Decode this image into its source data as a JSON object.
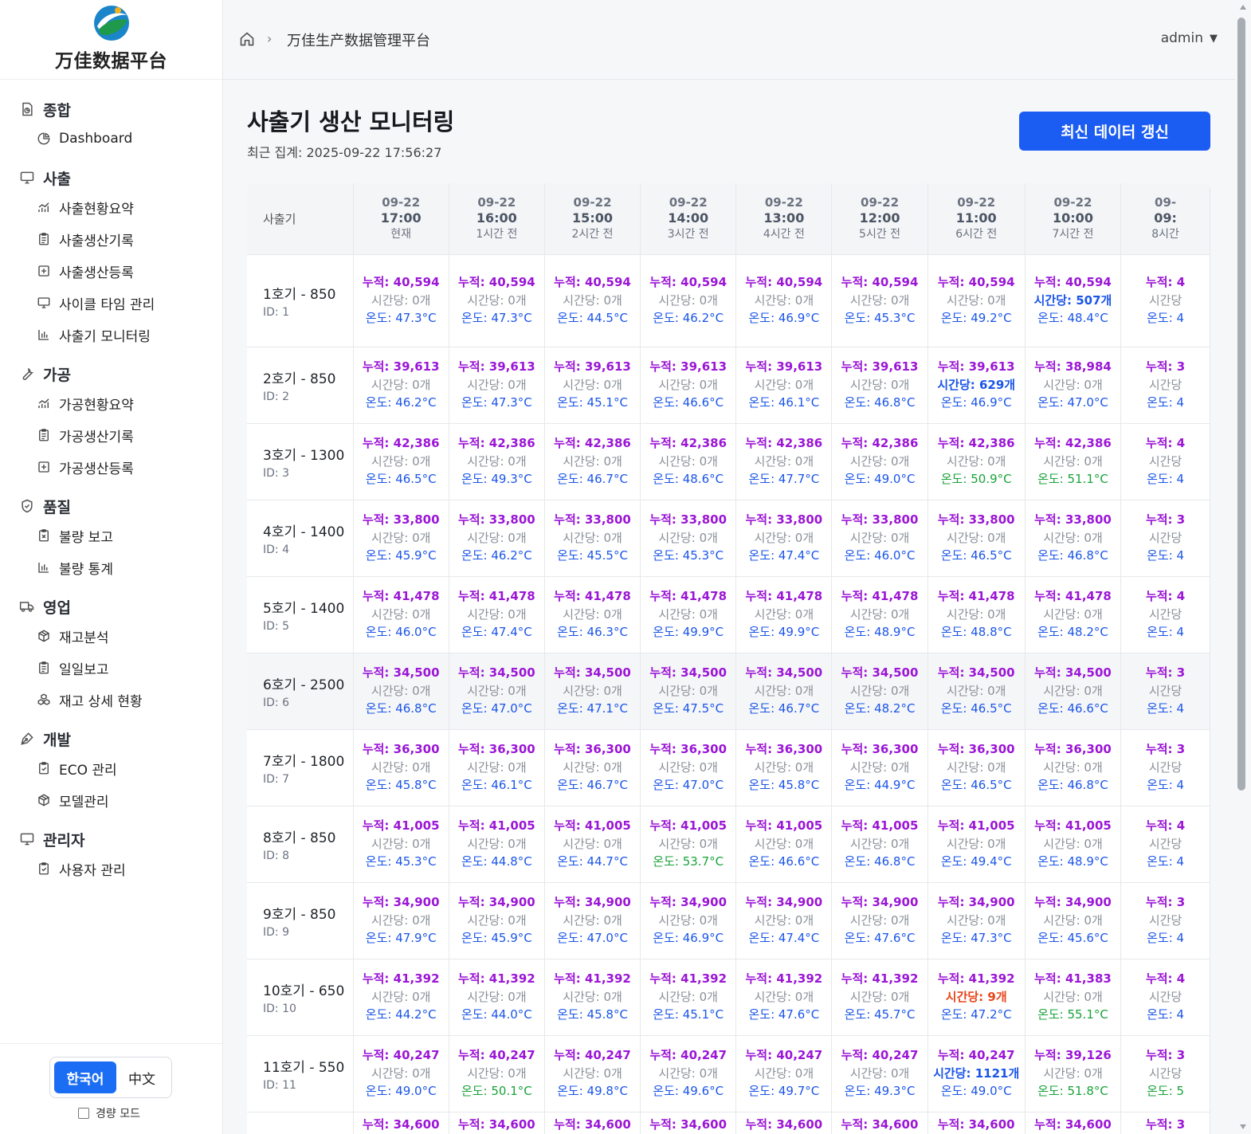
{
  "app": {
    "logo_text": "万佳数据平台"
  },
  "header": {
    "breadcrumb": "万佳生产数据管理平台",
    "user": "admin"
  },
  "sidebar": {
    "groups": [
      {
        "title": "종합",
        "icon": "overview-icon",
        "items": [
          {
            "label": "Dashboard",
            "icon": "pie-chart-icon"
          }
        ]
      },
      {
        "title": "사출",
        "icon": "monitor-icon",
        "items": [
          {
            "label": "사출현황요약",
            "icon": "line-chart-icon"
          },
          {
            "label": "사출생산기록",
            "icon": "clipboard-icon"
          },
          {
            "label": "사출생산등록",
            "icon": "plus-square-icon"
          },
          {
            "label": "사이클 타임 관리",
            "icon": "monitor-icon"
          },
          {
            "label": "사출기 모니터링",
            "icon": "bar-chart-icon"
          }
        ]
      },
      {
        "title": "가공",
        "icon": "wrench-icon",
        "items": [
          {
            "label": "가공현황요약",
            "icon": "line-chart-icon"
          },
          {
            "label": "가공생산기록",
            "icon": "clipboard-icon"
          },
          {
            "label": "가공생산등록",
            "icon": "plus-square-icon"
          }
        ]
      },
      {
        "title": "품질",
        "icon": "shield-icon",
        "items": [
          {
            "label": "불량 보고",
            "icon": "clipboard-x-icon"
          },
          {
            "label": "불량 통계",
            "icon": "bar-chart-icon"
          }
        ]
      },
      {
        "title": "영업",
        "icon": "truck-icon",
        "items": [
          {
            "label": "재고분석",
            "icon": "package-icon"
          },
          {
            "label": "일일보고",
            "icon": "clipboard-icon"
          },
          {
            "label": "재고 상세 현황",
            "icon": "boxes-icon"
          }
        ]
      },
      {
        "title": "개발",
        "icon": "pen-tool-icon",
        "items": [
          {
            "label": "ECO 관리",
            "icon": "clipboard-check-icon"
          },
          {
            "label": "모델관리",
            "icon": "package-icon"
          }
        ]
      },
      {
        "title": "관리자",
        "icon": "monitor-icon",
        "items": [
          {
            "label": "사용자 관리",
            "icon": "clipboard-check-icon"
          }
        ]
      }
    ],
    "languages": {
      "active": "한국어",
      "other": "中文"
    },
    "light_mode_label": "경량 모드",
    "light_mode_checked": false
  },
  "page": {
    "title": "사출기 생산 모니터링",
    "last_updated": "최근 집계: 2025-09-22 17:56:27",
    "refresh_label": "최신 데이터 갱신"
  },
  "table": {
    "machine_header": "사출기",
    "columns": [
      {
        "date": "09-22",
        "time": "17:00",
        "ago": "현재"
      },
      {
        "date": "09-22",
        "time": "16:00",
        "ago": "1시간 전"
      },
      {
        "date": "09-22",
        "time": "15:00",
        "ago": "2시간 전"
      },
      {
        "date": "09-22",
        "time": "14:00",
        "ago": "3시간 전"
      },
      {
        "date": "09-22",
        "time": "13:00",
        "ago": "4시간 전"
      },
      {
        "date": "09-22",
        "time": "12:00",
        "ago": "5시간 전"
      },
      {
        "date": "09-22",
        "time": "11:00",
        "ago": "6시간 전"
      },
      {
        "date": "09-22",
        "time": "10:00",
        "ago": "7시간 전"
      },
      {
        "date": "09-",
        "time": "09:",
        "ago": "8시간"
      }
    ],
    "rows": [
      {
        "name": "1호기 - 850",
        "id": "ID: 1",
        "cells": [
          [
            "누적: 40,594",
            "시간당: 0개",
            "온도: 47.3°C",
            "",
            ""
          ],
          [
            "누적: 40,594",
            "시간당: 0개",
            "온도: 47.3°C",
            "",
            ""
          ],
          [
            "누적: 40,594",
            "시간당: 0개",
            "온도: 44.5°C",
            "",
            ""
          ],
          [
            "누적: 40,594",
            "시간당: 0개",
            "온도: 46.2°C",
            "",
            ""
          ],
          [
            "누적: 40,594",
            "시간당: 0개",
            "온도: 46.9°C",
            "",
            ""
          ],
          [
            "누적: 40,594",
            "시간당: 0개",
            "온도: 45.3°C",
            "",
            ""
          ],
          [
            "누적: 40,594",
            "시간당: 0개",
            "온도: 49.2°C",
            "",
            ""
          ],
          [
            "누적: 40,594",
            "시간당: 507개",
            "온도: 48.4°C",
            "hi",
            ""
          ],
          [
            "누적: 4",
            "시간당",
            "온도: 4",
            "",
            ""
          ]
        ]
      },
      {
        "name": "2호기 - 850",
        "id": "ID: 2",
        "cells": [
          [
            "누적: 39,613",
            "시간당: 0개",
            "온도: 46.2°C",
            "",
            ""
          ],
          [
            "누적: 39,613",
            "시간당: 0개",
            "온도: 47.3°C",
            "",
            ""
          ],
          [
            "누적: 39,613",
            "시간당: 0개",
            "온도: 45.1°C",
            "",
            ""
          ],
          [
            "누적: 39,613",
            "시간당: 0개",
            "온도: 46.6°C",
            "",
            ""
          ],
          [
            "누적: 39,613",
            "시간당: 0개",
            "온도: 46.1°C",
            "",
            ""
          ],
          [
            "누적: 39,613",
            "시간당: 0개",
            "온도: 46.8°C",
            "",
            ""
          ],
          [
            "누적: 39,613",
            "시간당: 629개",
            "온도: 46.9°C",
            "hi",
            ""
          ],
          [
            "누적: 38,984",
            "시간당: 0개",
            "온도: 47.0°C",
            "",
            ""
          ],
          [
            "누적: 3",
            "시간당",
            "온도: 4",
            "",
            ""
          ]
        ]
      },
      {
        "name": "3호기 - 1300",
        "id": "ID: 3",
        "cells": [
          [
            "누적: 42,386",
            "시간당: 0개",
            "온도: 46.5°C",
            "",
            ""
          ],
          [
            "누적: 42,386",
            "시간당: 0개",
            "온도: 49.3°C",
            "",
            ""
          ],
          [
            "누적: 42,386",
            "시간당: 0개",
            "온도: 46.7°C",
            "",
            ""
          ],
          [
            "누적: 42,386",
            "시간당: 0개",
            "온도: 48.6°C",
            "",
            ""
          ],
          [
            "누적: 42,386",
            "시간당: 0개",
            "온도: 47.7°C",
            "",
            ""
          ],
          [
            "누적: 42,386",
            "시간당: 0개",
            "온도: 49.0°C",
            "",
            ""
          ],
          [
            "누적: 42,386",
            "시간당: 0개",
            "온도: 50.9°C",
            "",
            "ok"
          ],
          [
            "누적: 42,386",
            "시간당: 0개",
            "온도: 51.1°C",
            "",
            "ok"
          ],
          [
            "누적: 4",
            "시간당",
            "온도: 4",
            "",
            ""
          ]
        ]
      },
      {
        "name": "4호기 - 1400",
        "id": "ID: 4",
        "cells": [
          [
            "누적: 33,800",
            "시간당: 0개",
            "온도: 45.9°C",
            "",
            ""
          ],
          [
            "누적: 33,800",
            "시간당: 0개",
            "온도: 46.2°C",
            "",
            ""
          ],
          [
            "누적: 33,800",
            "시간당: 0개",
            "온도: 45.5°C",
            "",
            ""
          ],
          [
            "누적: 33,800",
            "시간당: 0개",
            "온도: 45.3°C",
            "",
            ""
          ],
          [
            "누적: 33,800",
            "시간당: 0개",
            "온도: 47.4°C",
            "",
            ""
          ],
          [
            "누적: 33,800",
            "시간당: 0개",
            "온도: 46.0°C",
            "",
            ""
          ],
          [
            "누적: 33,800",
            "시간당: 0개",
            "온도: 46.5°C",
            "",
            ""
          ],
          [
            "누적: 33,800",
            "시간당: 0개",
            "온도: 46.8°C",
            "",
            ""
          ],
          [
            "누적: 3",
            "시간당",
            "온도: 4",
            "",
            ""
          ]
        ]
      },
      {
        "name": "5호기 - 1400",
        "id": "ID: 5",
        "cells": [
          [
            "누적: 41,478",
            "시간당: 0개",
            "온도: 46.0°C",
            "",
            ""
          ],
          [
            "누적: 41,478",
            "시간당: 0개",
            "온도: 47.4°C",
            "",
            ""
          ],
          [
            "누적: 41,478",
            "시간당: 0개",
            "온도: 46.3°C",
            "",
            ""
          ],
          [
            "누적: 41,478",
            "시간당: 0개",
            "온도: 49.9°C",
            "",
            ""
          ],
          [
            "누적: 41,478",
            "시간당: 0개",
            "온도: 49.9°C",
            "",
            ""
          ],
          [
            "누적: 41,478",
            "시간당: 0개",
            "온도: 48.9°C",
            "",
            ""
          ],
          [
            "누적: 41,478",
            "시간당: 0개",
            "온도: 48.8°C",
            "",
            ""
          ],
          [
            "누적: 41,478",
            "시간당: 0개",
            "온도: 48.2°C",
            "",
            ""
          ],
          [
            "누적: 4",
            "시간당",
            "온도: 4",
            "",
            ""
          ]
        ]
      },
      {
        "name": "6호기 - 2500",
        "id": "ID: 6",
        "cells": [
          [
            "누적: 34,500",
            "시간당: 0개",
            "온도: 46.8°C",
            "",
            ""
          ],
          [
            "누적: 34,500",
            "시간당: 0개",
            "온도: 47.0°C",
            "",
            ""
          ],
          [
            "누적: 34,500",
            "시간당: 0개",
            "온도: 47.1°C",
            "",
            ""
          ],
          [
            "누적: 34,500",
            "시간당: 0개",
            "온도: 47.5°C",
            "",
            ""
          ],
          [
            "누적: 34,500",
            "시간당: 0개",
            "온도: 46.7°C",
            "",
            ""
          ],
          [
            "누적: 34,500",
            "시간당: 0개",
            "온도: 48.2°C",
            "",
            ""
          ],
          [
            "누적: 34,500",
            "시간당: 0개",
            "온도: 46.5°C",
            "",
            ""
          ],
          [
            "누적: 34,500",
            "시간당: 0개",
            "온도: 46.6°C",
            "",
            ""
          ],
          [
            "누적: 3",
            "시간당",
            "온도: 4",
            "",
            ""
          ]
        ]
      },
      {
        "name": "7호기 - 1800",
        "id": "ID: 7",
        "cells": [
          [
            "누적: 36,300",
            "시간당: 0개",
            "온도: 45.8°C",
            "",
            ""
          ],
          [
            "누적: 36,300",
            "시간당: 0개",
            "온도: 46.1°C",
            "",
            ""
          ],
          [
            "누적: 36,300",
            "시간당: 0개",
            "온도: 46.7°C",
            "",
            ""
          ],
          [
            "누적: 36,300",
            "시간당: 0개",
            "온도: 47.0°C",
            "",
            ""
          ],
          [
            "누적: 36,300",
            "시간당: 0개",
            "온도: 45.8°C",
            "",
            ""
          ],
          [
            "누적: 36,300",
            "시간당: 0개",
            "온도: 44.9°C",
            "",
            ""
          ],
          [
            "누적: 36,300",
            "시간당: 0개",
            "온도: 46.5°C",
            "",
            ""
          ],
          [
            "누적: 36,300",
            "시간당: 0개",
            "온도: 46.8°C",
            "",
            ""
          ],
          [
            "누적: 3",
            "시간당",
            "온도: 4",
            "",
            ""
          ]
        ]
      },
      {
        "name": "8호기 - 850",
        "id": "ID: 8",
        "cells": [
          [
            "누적: 41,005",
            "시간당: 0개",
            "온도: 45.3°C",
            "",
            ""
          ],
          [
            "누적: 41,005",
            "시간당: 0개",
            "온도: 44.8°C",
            "",
            ""
          ],
          [
            "누적: 41,005",
            "시간당: 0개",
            "온도: 44.7°C",
            "",
            ""
          ],
          [
            "누적: 41,005",
            "시간당: 0개",
            "온도: 53.7°C",
            "",
            "ok"
          ],
          [
            "누적: 41,005",
            "시간당: 0개",
            "온도: 46.6°C",
            "",
            ""
          ],
          [
            "누적: 41,005",
            "시간당: 0개",
            "온도: 46.8°C",
            "",
            ""
          ],
          [
            "누적: 41,005",
            "시간당: 0개",
            "온도: 49.4°C",
            "",
            ""
          ],
          [
            "누적: 41,005",
            "시간당: 0개",
            "온도: 48.9°C",
            "",
            ""
          ],
          [
            "누적: 4",
            "시간당",
            "온도: 4",
            "",
            ""
          ]
        ]
      },
      {
        "name": "9호기 - 850",
        "id": "ID: 9",
        "cells": [
          [
            "누적: 34,900",
            "시간당: 0개",
            "온도: 47.9°C",
            "",
            ""
          ],
          [
            "누적: 34,900",
            "시간당: 0개",
            "온도: 45.9°C",
            "",
            ""
          ],
          [
            "누적: 34,900",
            "시간당: 0개",
            "온도: 47.0°C",
            "",
            ""
          ],
          [
            "누적: 34,900",
            "시간당: 0개",
            "온도: 46.9°C",
            "",
            ""
          ],
          [
            "누적: 34,900",
            "시간당: 0개",
            "온도: 47.4°C",
            "",
            ""
          ],
          [
            "누적: 34,900",
            "시간당: 0개",
            "온도: 47.6°C",
            "",
            ""
          ],
          [
            "누적: 34,900",
            "시간당: 0개",
            "온도: 47.3°C",
            "",
            ""
          ],
          [
            "누적: 34,900",
            "시간당: 0개",
            "온도: 45.6°C",
            "",
            ""
          ],
          [
            "누적: 3",
            "시간당",
            "온도: 4",
            "",
            ""
          ]
        ]
      },
      {
        "name": "10호기 - 650",
        "id": "ID: 10",
        "cells": [
          [
            "누적: 41,392",
            "시간당: 0개",
            "온도: 44.2°C",
            "",
            ""
          ],
          [
            "누적: 41,392",
            "시간당: 0개",
            "온도: 44.0°C",
            "",
            ""
          ],
          [
            "누적: 41,392",
            "시간당: 0개",
            "온도: 45.8°C",
            "",
            ""
          ],
          [
            "누적: 41,392",
            "시간당: 0개",
            "온도: 45.1°C",
            "",
            ""
          ],
          [
            "누적: 41,392",
            "시간당: 0개",
            "온도: 47.6°C",
            "",
            ""
          ],
          [
            "누적: 41,392",
            "시간당: 0개",
            "온도: 45.7°C",
            "",
            ""
          ],
          [
            "누적: 41,392",
            "시간당: 9개",
            "온도: 47.2°C",
            "warn",
            ""
          ],
          [
            "누적: 41,383",
            "시간당: 0개",
            "온도: 55.1°C",
            "",
            "ok"
          ],
          [
            "누적: 4",
            "시간당",
            "온도: 4",
            "",
            ""
          ]
        ]
      },
      {
        "name": "11호기 - 550",
        "id": "ID: 11",
        "cells": [
          [
            "누적: 40,247",
            "시간당: 0개",
            "온도: 49.0°C",
            "",
            ""
          ],
          [
            "누적: 40,247",
            "시간당: 0개",
            "온도: 50.1°C",
            "",
            "ok"
          ],
          [
            "누적: 40,247",
            "시간당: 0개",
            "온도: 49.8°C",
            "",
            ""
          ],
          [
            "누적: 40,247",
            "시간당: 0개",
            "온도: 49.6°C",
            "",
            ""
          ],
          [
            "누적: 40,247",
            "시간당: 0개",
            "온도: 49.7°C",
            "",
            ""
          ],
          [
            "누적: 40,247",
            "시간당: 0개",
            "온도: 49.3°C",
            "",
            ""
          ],
          [
            "누적: 40,247",
            "시간당: 1121개",
            "온도: 49.0°C",
            "hi",
            ""
          ],
          [
            "누적: 39,126",
            "시간당: 0개",
            "온도: 51.8°C",
            "",
            "ok"
          ],
          [
            "누적: 3",
            "시간당",
            "온도: 5",
            "",
            "ok"
          ]
        ]
      },
      {
        "name": "",
        "id": "",
        "cells": [
          [
            "누적: 34,600",
            "",
            "",
            "",
            ""
          ],
          [
            "누적: 34,600",
            "",
            "",
            "",
            ""
          ],
          [
            "누적: 34,600",
            "",
            "",
            "",
            ""
          ],
          [
            "누적: 34,600",
            "",
            "",
            "",
            ""
          ],
          [
            "누적: 34,600",
            "",
            "",
            "",
            ""
          ],
          [
            "누적: 34,600",
            "",
            "",
            "",
            ""
          ],
          [
            "누적: 34,600",
            "",
            "",
            "",
            ""
          ],
          [
            "누적: 34,600",
            "",
            "",
            "",
            ""
          ],
          [
            "누적: 3",
            "",
            "",
            "",
            ""
          ]
        ]
      }
    ]
  }
}
